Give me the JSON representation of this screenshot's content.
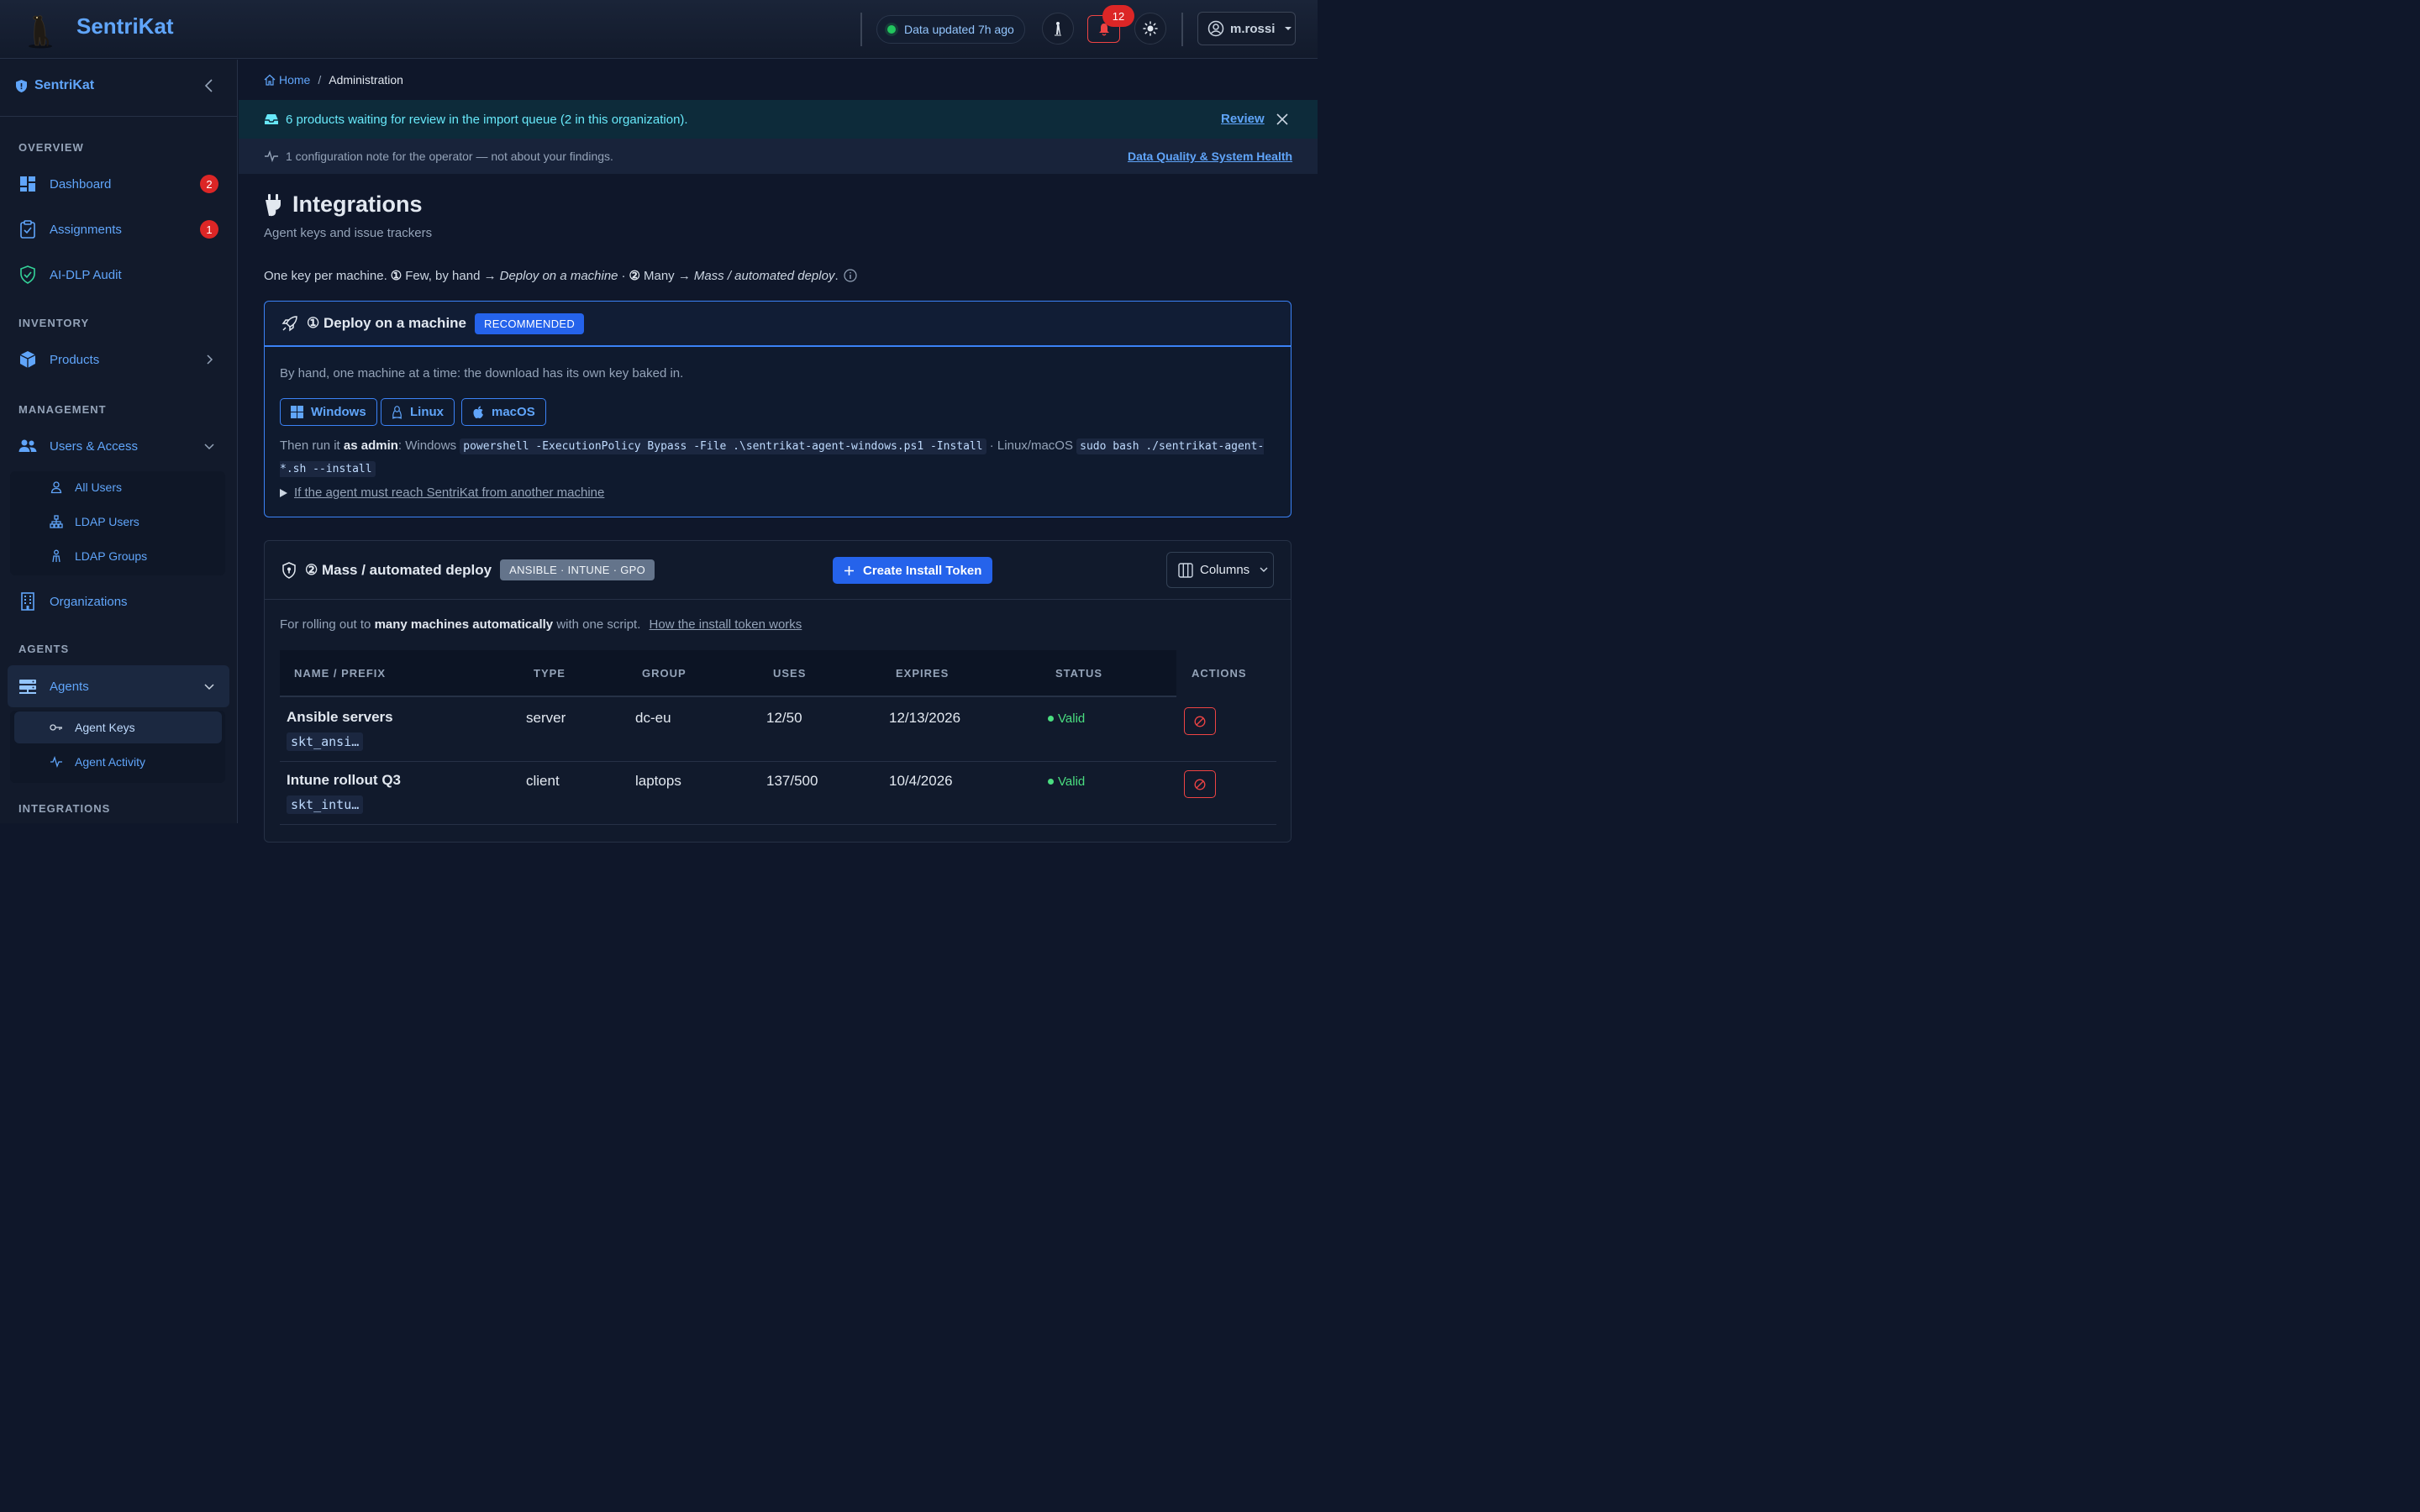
{
  "app": {
    "title": "SentriKat"
  },
  "topbar": {
    "status_text": "Data updated 7h ago",
    "notifications_count": "12",
    "user_name": "m.rossi"
  },
  "sidebar": {
    "brand": "SentriKat",
    "sections": {
      "overview": "OVERVIEW",
      "inventory": "INVENTORY",
      "management": "MANAGEMENT",
      "agents": "AGENTS",
      "integrations": "INTEGRATIONS"
    },
    "items": {
      "dashboard": {
        "label": "Dashboard",
        "badge": "2"
      },
      "assignments": {
        "label": "Assignments",
        "badge": "1"
      },
      "ai_dlp": {
        "label": "AI-DLP Audit"
      },
      "products": {
        "label": "Products"
      },
      "users_access": {
        "label": "Users & Access"
      },
      "all_users": {
        "label": "All Users"
      },
      "ldap_users": {
        "label": "LDAP Users"
      },
      "ldap_groups": {
        "label": "LDAP Groups"
      },
      "organizations": {
        "label": "Organizations"
      },
      "agents": {
        "label": "Agents"
      },
      "agent_keys": {
        "label": "Agent Keys"
      },
      "agent_activity": {
        "label": "Agent Activity"
      }
    }
  },
  "breadcrumb": {
    "home": "Home",
    "separator": "/",
    "current": "Administration"
  },
  "banners": {
    "review_text": "6 products waiting for review in the import queue (2 in this organization).",
    "review_link": "Review",
    "health_text": "1 configuration note for the operator — not about your findings.",
    "health_link": "Data Quality & System Health"
  },
  "page": {
    "title": "Integrations",
    "subtitle": "Agent keys and issue trackers",
    "intro": {
      "p1": "One key per machine.",
      "n1": "①",
      "p2": "Few, by hand →",
      "e1": "Deploy on a machine",
      "p3": "·",
      "n2": "②",
      "p4": "Many →",
      "e2": "Mass / automated deploy",
      "p5": "."
    }
  },
  "deploy_card": {
    "title": "① Deploy on a machine",
    "badge": "RECOMMENDED",
    "description": "By hand, one machine at a time: the download has its own key baked in.",
    "os_buttons": {
      "windows": "Windows",
      "linux": "Linux",
      "macos": "macOS"
    },
    "run": {
      "prefix": "Then run it",
      "as_admin": "as admin",
      "windows_label": ": Windows",
      "windows_cmd": "powershell -ExecutionPolicy Bypass -File .\\sentrikat-agent-windows.ps1 -Install",
      "mid": "· Linux/macOS",
      "linux_cmd": "sudo bash ./sentrikat-agent-*.sh --install"
    },
    "details_summary": "If the agent must reach SentriKat from another machine"
  },
  "mass_card": {
    "title": "② Mass / automated deploy",
    "badge": "ANSIBLE · INTUNE · GPO",
    "create_button": "Create Install Token",
    "columns_button": "Columns",
    "desc_pre": "For rolling out to",
    "desc_bold": "many machines automatically",
    "desc_post": "with one script.",
    "desc_link": "How the install token works",
    "table": {
      "headers": {
        "name": "NAME / PREFIX",
        "type": "TYPE",
        "group": "GROUP",
        "uses": "USES",
        "expires": "EXPIRES",
        "status": "STATUS",
        "actions": "ACTIONS"
      },
      "rows": [
        {
          "name": "Ansible servers",
          "prefix": "skt_ansi…",
          "type": "server",
          "group": "dc-eu",
          "uses": "12/50",
          "expires": "12/13/2026",
          "status": "Valid"
        },
        {
          "name": "Intune rollout Q3",
          "prefix": "skt_intu…",
          "type": "client",
          "group": "laptops",
          "uses": "137/500",
          "expires": "10/4/2026",
          "status": "Valid"
        }
      ]
    }
  },
  "colors": {
    "accent": "#60a5fa",
    "primary_button": "#2563eb",
    "danger": "#dc2626",
    "success": "#4ade80",
    "background": "#0f172a"
  },
  "icons": {
    "logo": "meerkat-logo",
    "history": "meerkat-history-icon",
    "bell": "bell-icon",
    "theme": "sun-icon",
    "user": "user-circle-icon"
  }
}
